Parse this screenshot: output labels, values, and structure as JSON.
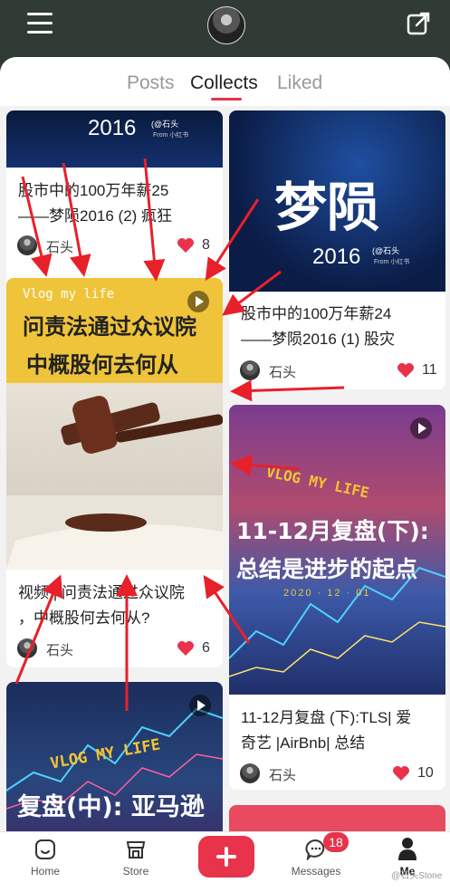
{
  "header": {
    "menu_icon": "hamburger-icon",
    "share_icon": "external-link-icon"
  },
  "tabs": [
    {
      "label": "Posts",
      "active": false
    },
    {
      "label": "Collects",
      "active": true
    },
    {
      "label": "Liked",
      "active": false
    }
  ],
  "accent_color": "#e8334a",
  "cards": [
    {
      "title_line1": "股市中的100万年薪25",
      "title_line2": "——梦陨2016 (2) 疯狂",
      "author": "石头",
      "likes": "8",
      "thumb": {
        "year": "2016",
        "badge": "(@石头",
        "sub": "From 小红书"
      }
    },
    {
      "title_line1": "视频 | 问责法通过众议院",
      "title_line2": "，中概股何去何从?",
      "author": "石头",
      "likes": "6",
      "thumb": {
        "vlog": "Vlog my life",
        "headline1": "问责法通过众议院",
        "headline2": "中概股何去何从"
      }
    },
    {
      "thumb": {
        "vlog": "VLOG MY LIFE",
        "headline": "复盘(中): 亚马逊"
      }
    },
    {
      "title_line1": "股市中的100万年薪24",
      "title_line2": "——梦陨2016 (1) 股灾",
      "author": "石头",
      "likes": "11",
      "thumb": {
        "big": "梦陨",
        "year": "2016",
        "badge": "(@石头",
        "sub": "From 小红书"
      }
    },
    {
      "title_line1": "11-12月复盘 (下):TLS| 爱",
      "title_line2": "奇艺 |AirBnb| 总结",
      "author": "石头",
      "likes": "10",
      "thumb": {
        "vlog": "VLOG MY LIFE",
        "headline1": "11-12月复盘(下):",
        "headline2": "总结是进步的起点",
        "date": "2020 · 12 · 01"
      }
    }
  ],
  "bottom_nav": {
    "home": "Home",
    "store": "Store",
    "messages": "Messages",
    "messages_badge": "18",
    "me": "Me"
  },
  "watermark": "@石头Stone"
}
